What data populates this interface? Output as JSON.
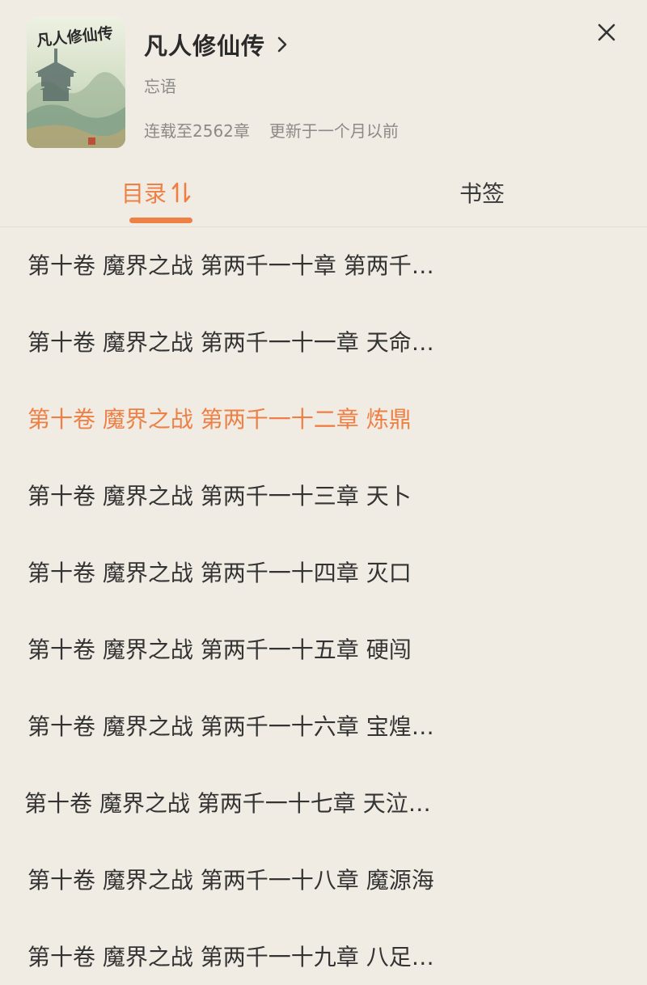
{
  "book": {
    "title": "凡人修仙传",
    "author": "忘语",
    "serial_status": "连载至2562章",
    "update_info": "更新于一个月以前",
    "cover_title": "凡人修仙传"
  },
  "tabs": {
    "catalog_label": "目录",
    "bookmark_label": "书签"
  },
  "chapters": [
    {
      "text": " 第十卷 魔界之战 第两千一十章 第两千…"
    },
    {
      "text": " 第十卷 魔界之战 第两千一十一章 天命…"
    },
    {
      "text": "第十卷 魔界之战 第两千一十二章 炼鼎"
    },
    {
      "text": "第十卷 魔界之战 第两千一十三章 天卜"
    },
    {
      "text": "第十卷 魔界之战 第两千一十四章 灭口"
    },
    {
      "text": "第十卷 魔界之战 第两千一十五章 硬闯"
    },
    {
      "text": " 第十卷 魔界之战 第两千一十六章 宝煌…"
    },
    {
      "text": " 第十卷 魔界之战 第两千一十七章  天泣…"
    },
    {
      "text": "第十卷 魔界之战 第两千一十八章 魔源海"
    },
    {
      "text": " 第十卷 魔界之战 第两千一十九章 八足…"
    }
  ],
  "current_chapter_index": 2,
  "icons": {
    "close": "close-icon",
    "chevron": "chevron-right-icon",
    "sort": "sort-icon"
  },
  "colors": {
    "accent": "#ee7f45",
    "background": "#f1ece3",
    "text": "#333333",
    "secondary_text": "#8d8a85"
  }
}
